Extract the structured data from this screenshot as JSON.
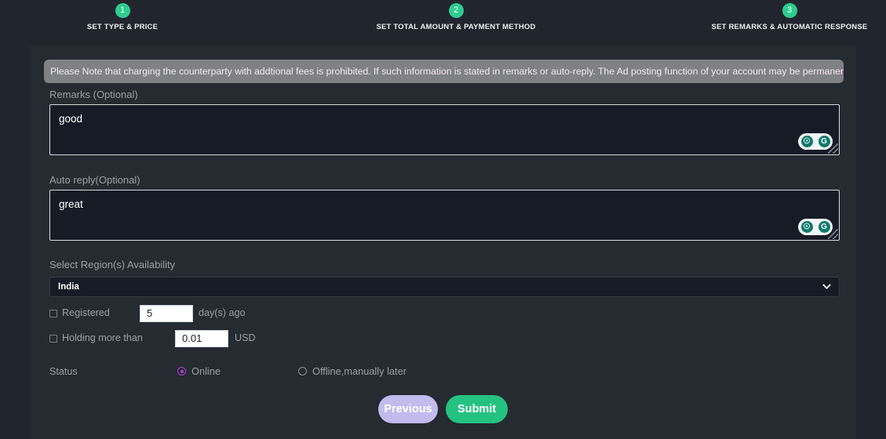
{
  "stepper": {
    "steps": [
      {
        "number": "1",
        "label": "SET TYPE & PRICE"
      },
      {
        "number": "2",
        "label": "SET TOTAL AMOUNT & PAYMENT METHOD"
      },
      {
        "number": "3",
        "label": "SET REMARKS & AUTOMATIC RESPONSE"
      }
    ],
    "circle_color": "#2ecc8f"
  },
  "notice": {
    "text": "Please Note that charging the counterparty with addtional fees is prohibited. If such information is stated in remarks or auto-reply. The Ad posting function of your account may be permanently blocked.",
    "background": "#7f8184",
    "text_color": "#f7e9ef"
  },
  "remarks": {
    "label": "Remarks (Optional)",
    "value": "good",
    "placeholder": ""
  },
  "auto_reply": {
    "label": "Auto reply(Optional)",
    "value": "great",
    "placeholder": ""
  },
  "grammarly": {
    "bulb_glyph": "☉",
    "g_glyph": "G",
    "accent": "#0c7a6a"
  },
  "region": {
    "label": "Select Region(s) Availability",
    "selected": "India",
    "chevron": "❯"
  },
  "registered": {
    "label": "Registered",
    "value": "5",
    "unit": "day(s) ago",
    "checked": false
  },
  "holding": {
    "label": "Holding more than",
    "value": "0.01",
    "unit": "USD",
    "checked": false
  },
  "status": {
    "label": "Status",
    "options": [
      {
        "label": "Online",
        "selected": true
      },
      {
        "label": "Offline,manually later",
        "selected": false
      }
    ],
    "selected_color": "#b13fd4"
  },
  "buttons": {
    "previous_label": "Previous",
    "previous_color": "#c3bbee",
    "submit_label": "Submit",
    "submit_color": "#24c280"
  }
}
